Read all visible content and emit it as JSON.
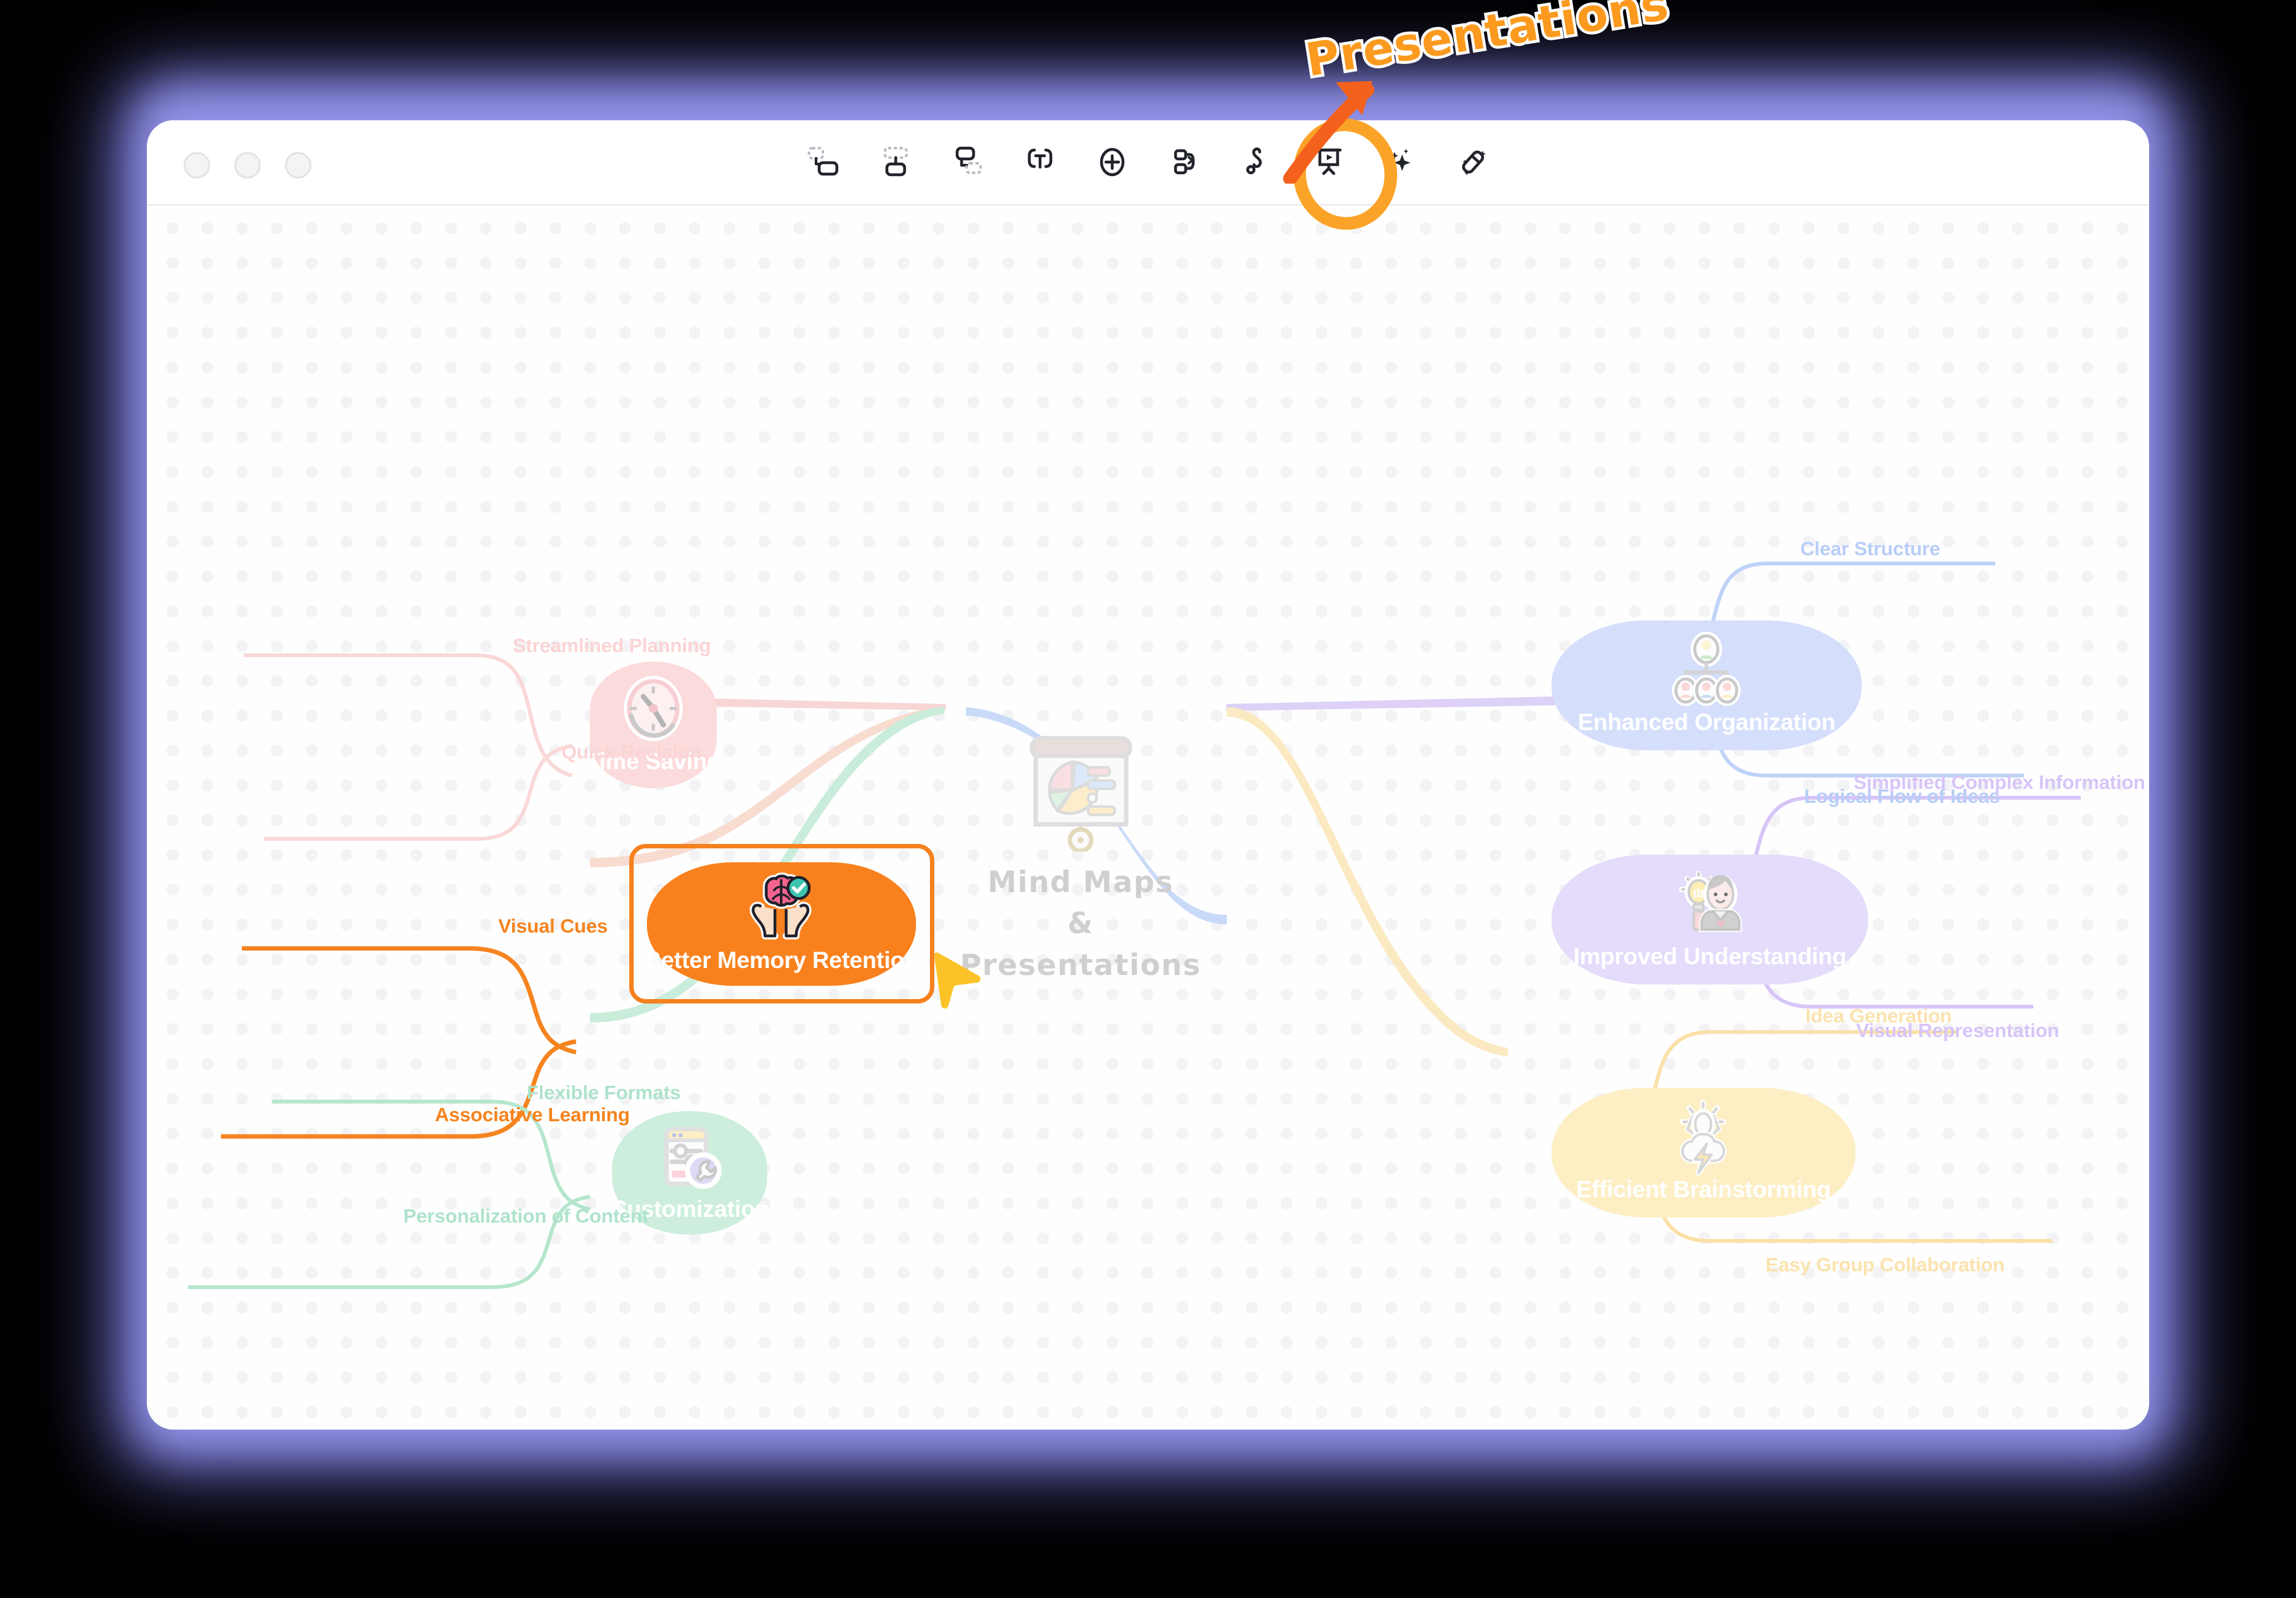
{
  "window": {
    "traffic_lights": [
      "close",
      "minimize",
      "maximize"
    ],
    "accent_glow": "#7c7ce0"
  },
  "toolbar": {
    "items": [
      {
        "id": "add-sibling-node",
        "label": "Add Sibling Topic",
        "icon": "sibling-node-icon"
      },
      {
        "id": "add-child-node",
        "label": "Add Child Topic",
        "icon": "child-node-icon"
      },
      {
        "id": "add-floating-node",
        "label": "Add Floating Topic",
        "icon": "floating-node-icon"
      },
      {
        "id": "text-style",
        "label": "Text",
        "icon": "text-bracket-icon"
      },
      {
        "id": "insert",
        "label": "Insert",
        "icon": "plus-circle-icon"
      },
      {
        "id": "relationship",
        "label": "Relationship",
        "icon": "relationship-icon"
      },
      {
        "id": "freehand",
        "label": "Freehand",
        "icon": "squiggle-icon"
      },
      {
        "id": "presentation",
        "label": "Presentation",
        "icon": "presentation-board-icon",
        "highlighted": true
      },
      {
        "id": "ai-assist",
        "label": "AI",
        "icon": "sparkle-icon"
      },
      {
        "id": "magic-tools",
        "label": "Magic Tools",
        "icon": "magic-wand-icon"
      }
    ]
  },
  "annotation": {
    "text": "Presentations",
    "text_color": "#fb9a1e",
    "outline_color": "#ffffff",
    "arrow_color": "#f4611c",
    "ring_color": "#fba328",
    "points_at": "presentation"
  },
  "mindmap": {
    "root": {
      "title_line1": "Mind Maps",
      "title_line2": "&",
      "title_line3": "Presentations",
      "icon": "presentation-chart-icon",
      "text_color": "#cfcfcf"
    },
    "branches": [
      {
        "id": "time-saving",
        "label": "Time Saving",
        "icon": "clock-icon",
        "color": "#fbdbdb",
        "line_color": "#f9d9cf",
        "leaf_color": "#fbd7d7",
        "side": "left",
        "dimmed": true,
        "leaves": [
          "Streamlined Planning",
          "Quick Revision"
        ]
      },
      {
        "id": "better-memory-retention",
        "label": "Better Memory Retention",
        "icon": "brain-hands-icon",
        "color": "#f9811d",
        "line_color": "#f5811f",
        "leaf_color": "#f5841f",
        "side": "left",
        "selected": true,
        "dimmed": false,
        "leaves": [
          "Visual Cues",
          "Associative Learning"
        ]
      },
      {
        "id": "customization",
        "label": "Customization",
        "icon": "settings-panel-icon",
        "color": "#cdeedd",
        "line_color": "#c8eadb",
        "leaf_color": "#a9e2c7",
        "side": "left",
        "dimmed": true,
        "leaves": [
          "Flexible Formats",
          "Personalization of Content"
        ]
      },
      {
        "id": "enhanced-organization",
        "label": "Enhanced Organization",
        "icon": "org-chart-icon",
        "color": "#d5dffb",
        "line_color": "#c6d7f8",
        "leaf_color": "#b8cdf7",
        "side": "right",
        "dimmed": true,
        "leaves": [
          "Clear Structure",
          "Logical Flow of Ideas"
        ]
      },
      {
        "id": "improved-understanding",
        "label": "Improved Understanding",
        "icon": "idea-person-icon",
        "color": "#e4dcfa",
        "line_color": "#ddd2f8",
        "leaf_color": "#d7c5f7",
        "side": "right",
        "dimmed": true,
        "leaves": [
          "Simplified Complex Information",
          "Visual Representation"
        ]
      },
      {
        "id": "efficient-brainstorming",
        "label": "Efficient Brainstorming",
        "icon": "brainstorm-bolt-icon",
        "color": "#fdeec4",
        "line_color": "#fbeac1",
        "leaf_color": "#fbe3ae",
        "side": "right",
        "dimmed": true,
        "leaves": [
          "Idea Generation",
          "Easy Group Collaboration"
        ]
      }
    ]
  },
  "cursor": {
    "type": "arrow-pointer",
    "color": "#fcc328"
  }
}
